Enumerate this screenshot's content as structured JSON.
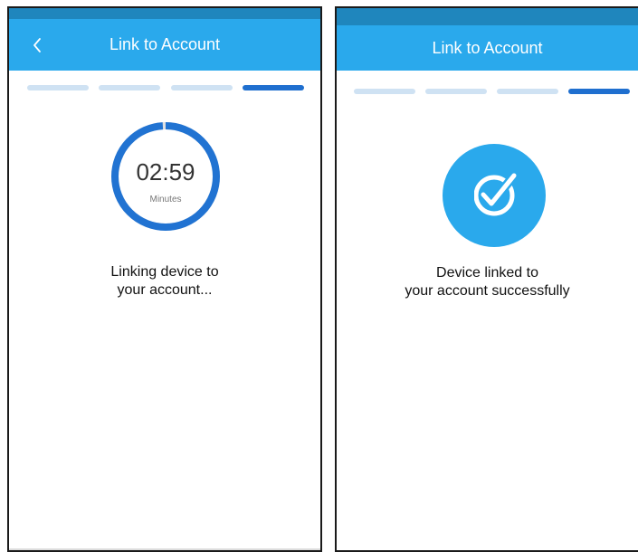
{
  "screens": [
    {
      "header_title": "Link to Account",
      "back_icon": "chevron-left-icon",
      "steps_total": 4,
      "step_current": 4,
      "timer_value": "02:59",
      "timer_unit": "Minutes",
      "timer_progress": 0.99,
      "message_line1": "Linking device to",
      "message_line2": "your account..."
    },
    {
      "header_title": "Link to Account",
      "steps_total": 4,
      "step_current": 4,
      "status_icon": "checkmark-circle-icon",
      "message_line1": "Device linked to",
      "message_line2": "your account successfully"
    }
  ],
  "colors": {
    "header": "#2aa9ec",
    "status_bar": "#1f86bd",
    "step_inactive": "#cfe2f3",
    "step_active": "#1f6fcf",
    "timer_ring": "#2173d2"
  }
}
